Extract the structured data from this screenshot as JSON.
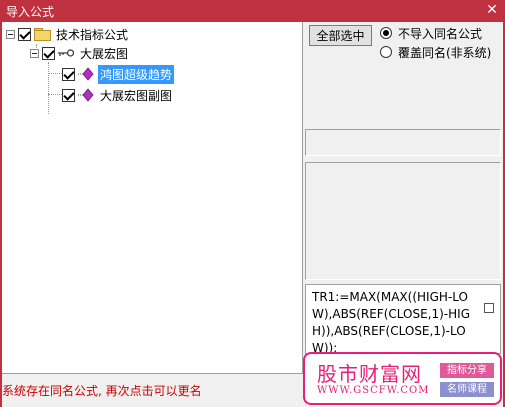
{
  "window": {
    "title": "导入公式",
    "close_glyph": "✕"
  },
  "tree": {
    "root": {
      "label": "技术指标公式",
      "checked": true
    },
    "group": {
      "label": "大展宏图",
      "checked": true
    },
    "items": [
      {
        "label": "鸿图超级趋势",
        "checked": true,
        "selected": true
      },
      {
        "label": "大展宏图副图",
        "checked": true,
        "selected": false
      }
    ]
  },
  "buttons": {
    "select_all": "全部选中"
  },
  "options": {
    "skip_same_name": {
      "label": "不导入同名公式",
      "selected": true
    },
    "overwrite_same_name": {
      "label": "覆盖同名(非系统)",
      "selected": false
    }
  },
  "code_preview": {
    "text": "TR1:=MAX(MAX((HIGH-LOW),ABS(REF(CLOSE,1)-HIGH)),ABS(REF(CLOSE,1)-LOW));"
  },
  "status": {
    "message": "系统存在同名公式, 再次点击可以更名"
  },
  "watermark": {
    "brand": "股市财富网",
    "url": "WWW.GSCFW.COM",
    "tag1": "指标分享",
    "tag2": "名师课程"
  },
  "colors": {
    "titlebar": "#c0313f",
    "selection": "#3399ff",
    "status_text": "#cc0000",
    "watermark": "#e91e78"
  }
}
